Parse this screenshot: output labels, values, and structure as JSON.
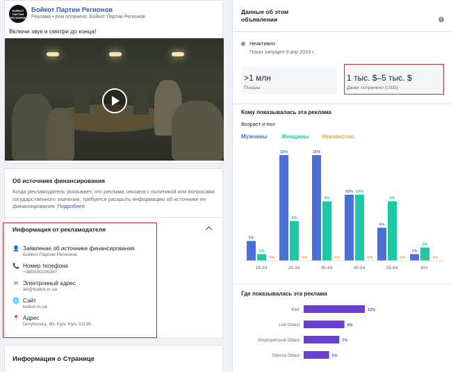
{
  "ad": {
    "page_name": "Бойкот Партии Регионов",
    "sponsor_prefix": "Реклама • Кем оплачено: ",
    "sponsor_name": "Бойкот Партии Регионов",
    "avatar_text": "БОЙКОТ ПАРТИИ РЕГИОНОВ",
    "text": "Включи звук и смотри до конца!"
  },
  "funding": {
    "title": "Об источнике финансирования",
    "text": "Когда рекламодатель указывает, что реклама связана с политикой или вопросами государственного значения, требуется раскрыть информацию об источнике ее финансирования.",
    "link": "Подробнее"
  },
  "advertiser": {
    "title": "Информация от рекламодателя",
    "rows": [
      {
        "icon": "person-icon",
        "glyph": "👤",
        "label": "Заявление об источнике финансирования",
        "value": "Бойкот Партии Регионов"
      },
      {
        "icon": "phone-icon",
        "glyph": "📞",
        "label": "Номер телефона",
        "value": "+380930106397"
      },
      {
        "icon": "email-icon",
        "glyph": "✉",
        "label": "Электронный адрес",
        "value": "ad@boikot.in.ua"
      },
      {
        "icon": "globe-icon",
        "glyph": "🌐",
        "label": "Сайт",
        "value": "boikot.in.ua"
      },
      {
        "icon": "location-icon",
        "glyph": "📍",
        "label": "Адрес",
        "value": "Dmytrivska, 80, Kyiv, Kyiv 01135"
      }
    ]
  },
  "page_info": {
    "title": "Информация о Странице"
  },
  "ad_data": {
    "title": "Данные об этом объявлении",
    "status": "Неактивно",
    "started": "Показ запущен 9 апр 2019 г.",
    "impressions_value": ">1 млн",
    "impressions_label": "Показы",
    "spent_value": "1 тыс. $–5 тыс. $",
    "spent_label": "Денег потрачено (USD)"
  },
  "audience": {
    "title": "Кому показывалась эта реклама",
    "subtitle": "Возраст и пол",
    "legend": {
      "men": "Мужчины",
      "women": "Женщины",
      "unknown": "Неизвестно"
    }
  },
  "locations_title": "Где показывалась эта реклама",
  "colors": {
    "men": "#4a6fd6",
    "women": "#1ec8a5",
    "unknown": "#f5a14a",
    "location": "#6b3fd6",
    "link": "#385898",
    "highlight": "#d0282d"
  },
  "chart_data": [
    {
      "type": "bar",
      "categories": [
        "18-24",
        "25-34",
        "35-44",
        "45-54",
        "55-64",
        "65+"
      ],
      "series": [
        {
          "name": "Мужчины",
          "values": [
            3,
            16,
            16,
            10,
            5,
            1
          ]
        },
        {
          "name": "Женщины",
          "values": [
            1,
            6,
            9,
            10,
            9,
            2
          ]
        },
        {
          "name": "Неизвестно",
          "values": [
            0,
            0,
            0,
            0,
            0,
            0
          ]
        }
      ],
      "value_suffix": "%",
      "ylim": [
        0,
        16
      ]
    },
    {
      "type": "bar",
      "orientation": "horizontal",
      "categories": [
        "Kiev",
        "Lviv Oblast",
        "Dnipropetrovsk Oblast",
        "Odessa Oblast"
      ],
      "values": [
        12,
        8,
        7,
        5
      ],
      "value_suffix": "%",
      "xlim": [
        0,
        12
      ]
    }
  ]
}
